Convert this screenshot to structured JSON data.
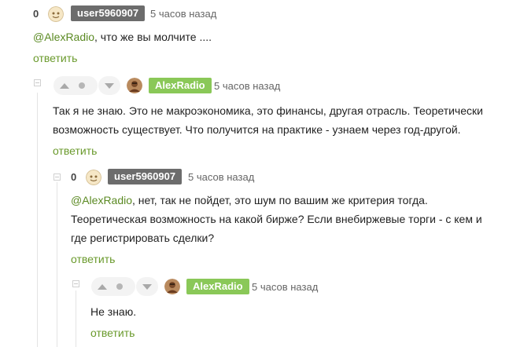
{
  "colors": {
    "accent": "#6a9a2c",
    "badge_gray": "#6c6c6c",
    "badge_green": "#8ac858",
    "thread_line": "#e4e4e4"
  },
  "comments": [
    {
      "rating": "0",
      "username": "user5960907",
      "time": "5 часов назад",
      "mention": "@AlexRadio",
      "text": ", что же вы молчите ....",
      "reply": "ответить"
    },
    {
      "username": "AlexRadio",
      "time": "5 часов назад",
      "text": "Так я не знаю. Это не макроэкономика, это финансы, другая отрасль. Теоретически возможность существует. Что получится на практике - узнаем через год-другой.",
      "reply": "ответить"
    },
    {
      "rating": "0",
      "username": "user5960907",
      "time": "5 часов назад",
      "mention": "@AlexRadio",
      "text": ", нет, так не пойдет, это шум по вашим же критерия тогда. Теоретическая возможность на какой бирже? Если внебиржевые торги - с кем и где регистрировать сделки?",
      "reply": "ответить"
    },
    {
      "username": "AlexRadio",
      "time": "5 часов назад",
      "text": "Не знаю.",
      "reply": "ответить"
    }
  ]
}
